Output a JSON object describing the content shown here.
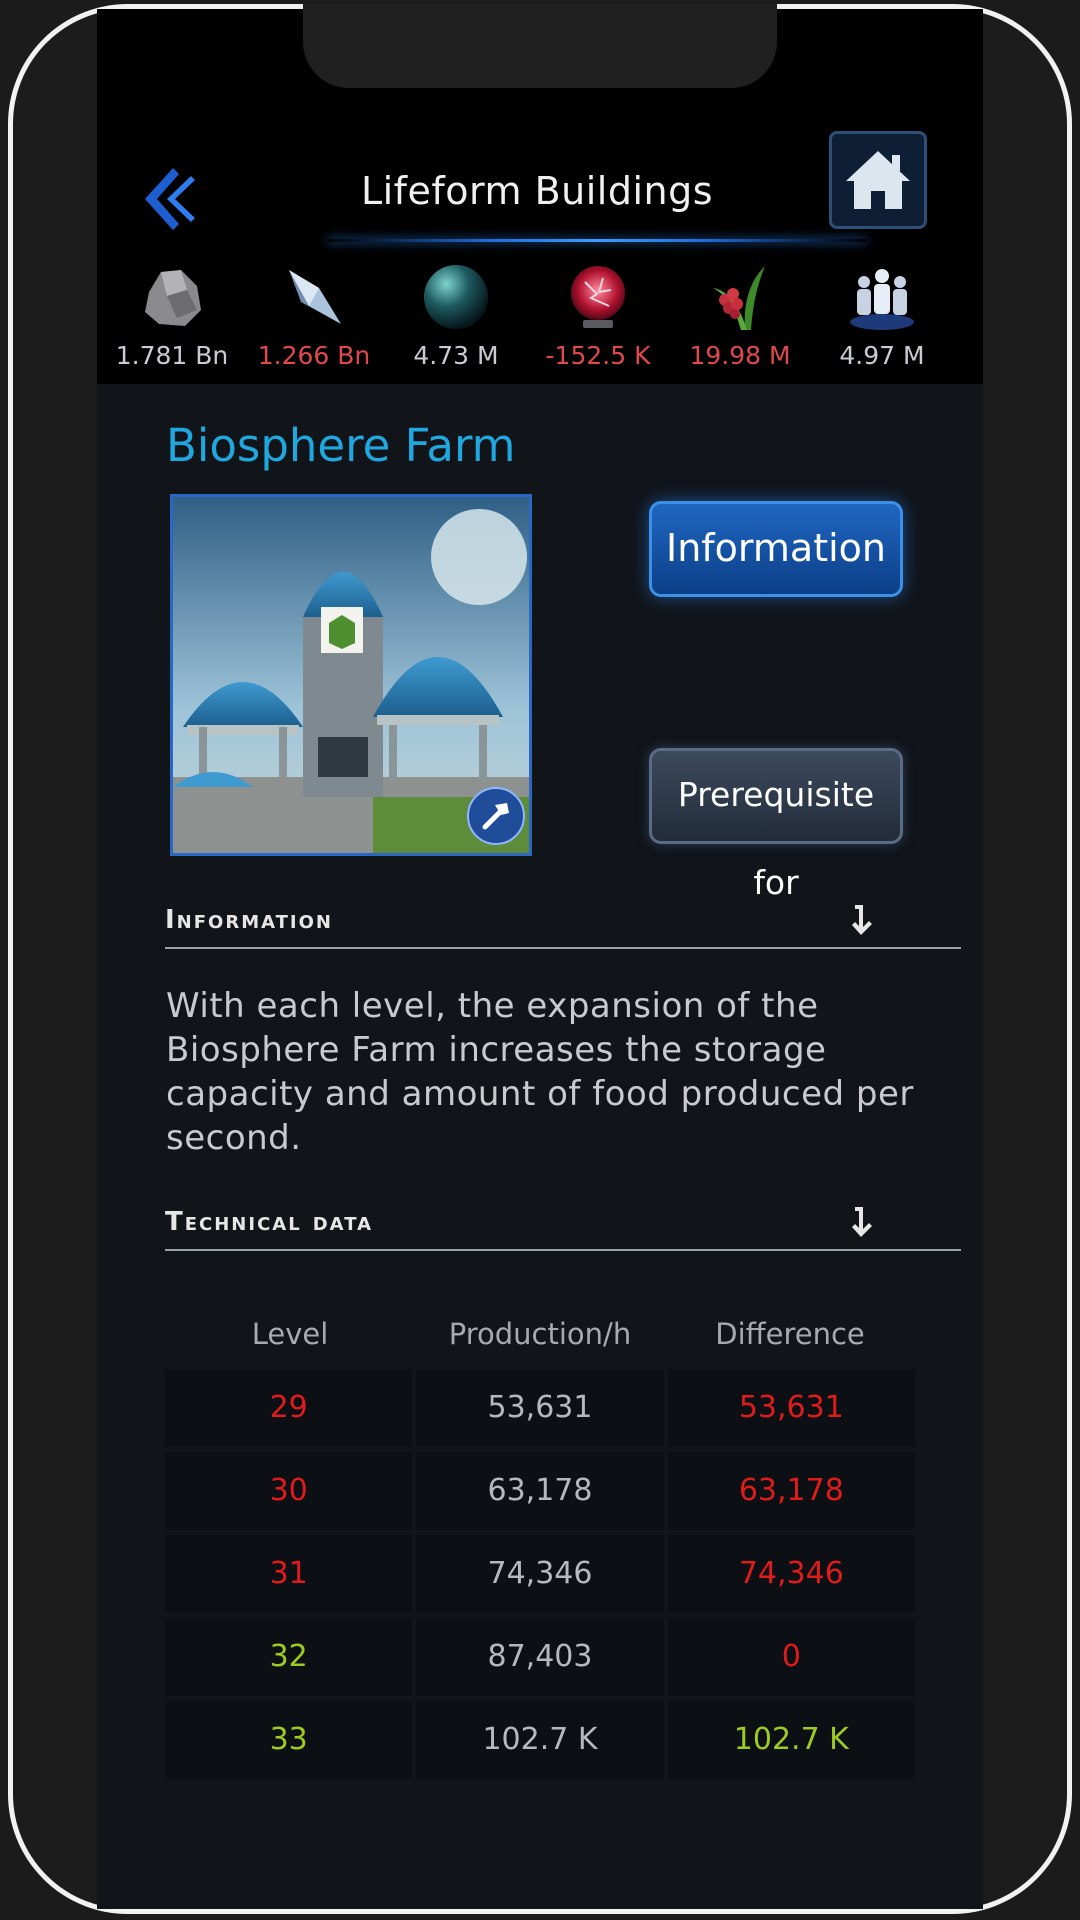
{
  "header": {
    "title": "Lifeform Buildings"
  },
  "resources": [
    {
      "icon": "metal-rock-icon",
      "value": "1.781 Bn",
      "negative": false
    },
    {
      "icon": "crystal-icon",
      "value": "1.266 Bn",
      "negative": true
    },
    {
      "icon": "deuterium-sphere-icon",
      "value": "4.73 M",
      "negative": false
    },
    {
      "icon": "energy-orb-icon",
      "value": "-152.5 K",
      "negative": true
    },
    {
      "icon": "food-plant-icon",
      "value": "19.98 M",
      "negative": true
    },
    {
      "icon": "population-icon",
      "value": "4.97 M",
      "negative": false
    }
  ],
  "building": {
    "name": "Biosphere Farm"
  },
  "buttons": {
    "information": "Information",
    "prerequisite": "Prerequisite for"
  },
  "sections": {
    "information": {
      "title": "Information",
      "text": "With each level, the expansion of the Biosphere Farm increases the storage capacity and amount of food produced per second."
    },
    "technical": {
      "title": "Technical data"
    }
  },
  "table": {
    "headers": [
      "Level",
      "Production/h",
      "Difference"
    ],
    "rows": [
      {
        "level": "29",
        "production": "53,631",
        "difference": "53,631",
        "level_color": "#e01b1b",
        "diff_color": "#e01b1b"
      },
      {
        "level": "30",
        "production": "63,178",
        "difference": "63,178",
        "level_color": "#e01b1b",
        "diff_color": "#e01b1b"
      },
      {
        "level": "31",
        "production": "74,346",
        "difference": "74,346",
        "level_color": "#e01b1b",
        "diff_color": "#e01b1b"
      },
      {
        "level": "32",
        "production": "87,403",
        "difference": "0",
        "level_color": "#9ecb1f",
        "diff_color": "#e01b1b"
      },
      {
        "level": "33",
        "production": "102.7 K",
        "difference": "102.7 K",
        "level_color": "#9ecb1f",
        "diff_color": "#9ecb1f"
      }
    ]
  },
  "colors": {
    "accent": "#1fa8e0",
    "negative": "#e0494c",
    "positive": "#9ecb1f"
  }
}
